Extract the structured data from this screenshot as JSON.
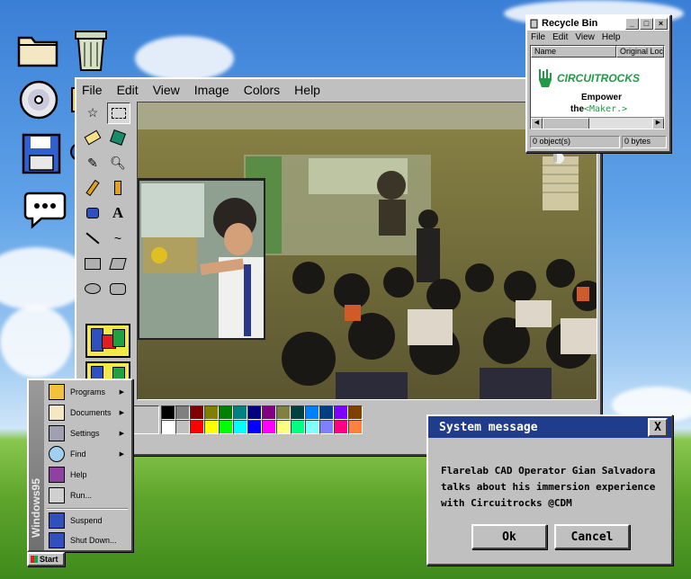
{
  "desktop": {
    "icons": [
      "folder-icon",
      "recycle-bin-icon",
      "cd-disc-icon",
      "floppy-disk-icon",
      "speech-bubble-icon"
    ]
  },
  "paint": {
    "menu": [
      "File",
      "Edit",
      "View",
      "Image",
      "Colors",
      "Help"
    ],
    "palette_row1": [
      "#000000",
      "#808080",
      "#800000",
      "#808000",
      "#008000",
      "#008080",
      "#000080",
      "#800080",
      "#808040",
      "#004040",
      "#0080ff",
      "#004080",
      "#8000ff",
      "#804000"
    ],
    "palette_row2": [
      "#ffffff",
      "#c0c0c0",
      "#ff0000",
      "#ffff00",
      "#00ff00",
      "#00ffff",
      "#0000ff",
      "#ff00ff",
      "#ffff80",
      "#00ff80",
      "#80ffff",
      "#8080ff",
      "#ff0080",
      "#ff8040"
    ]
  },
  "recycle_bin": {
    "title": "Recycle Bin",
    "menu": [
      "File",
      "Edit",
      "View",
      "Help"
    ],
    "columns": [
      "Name",
      "Original Locatio"
    ],
    "logo_text": "CIRCUITROCKS",
    "slogan_line1": "Empower",
    "slogan_the": "the",
    "slogan_maker": "<Maker.>",
    "status_left": "0 object(s)",
    "status_right": "0 bytes"
  },
  "dialog": {
    "title": "System message",
    "message": "Flarelab CAD Operator Gian Salvadora talks about his immersion experience with Circuitrocks @CDM",
    "ok_label": "Ok",
    "cancel_label": "Cancel",
    "close_label": "X"
  },
  "start_menu": {
    "side_text": "Windows95",
    "items": [
      "Programs",
      "Documents",
      "Settings",
      "Find",
      "Help",
      "Run...",
      "Suspend",
      "Shut Down..."
    ],
    "start_label": "Start"
  },
  "colors": {
    "title_blue": "#1f3d8c",
    "face": "#c0c0c0",
    "brand_green": "#1f9a45"
  }
}
